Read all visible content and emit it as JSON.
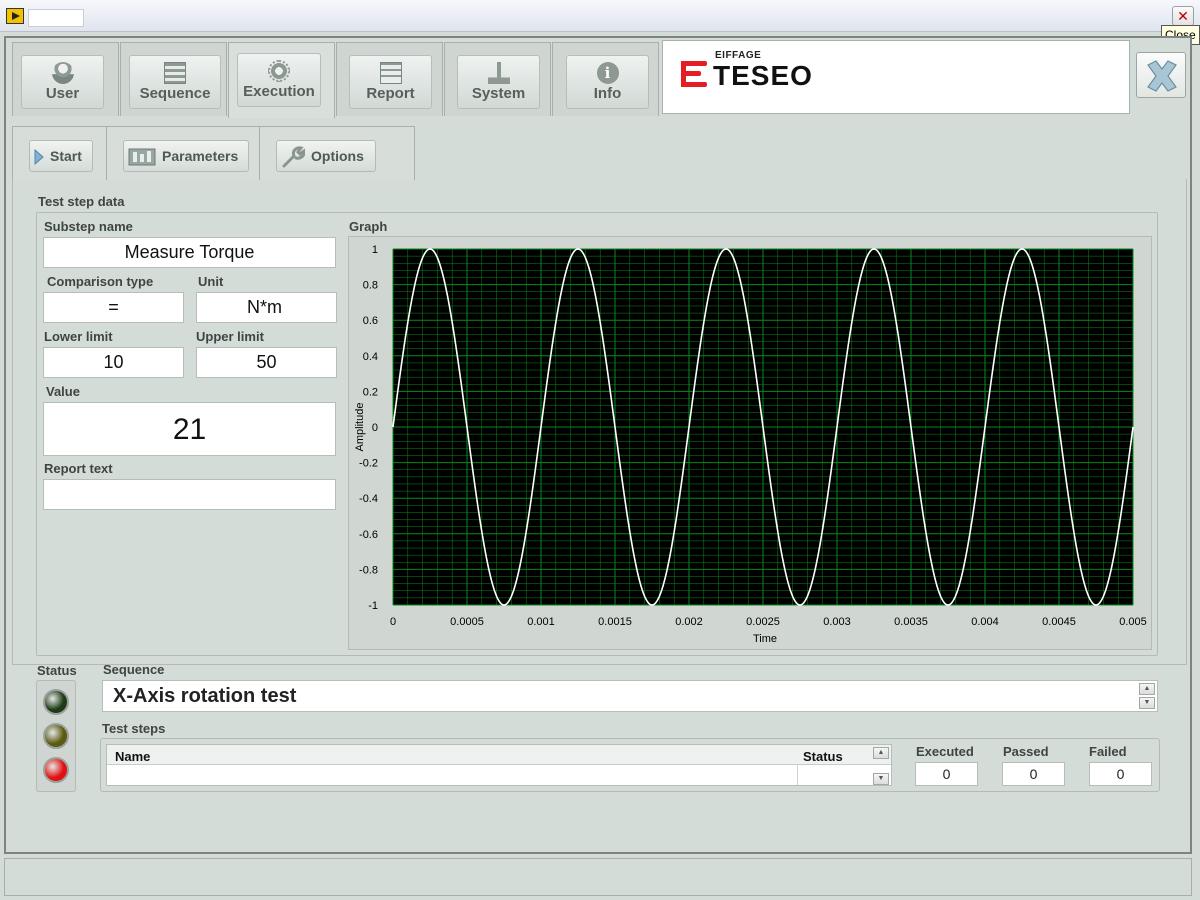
{
  "window": {
    "close_glyph": "✕",
    "close_tooltip": "Close"
  },
  "main_tabs": [
    {
      "label": "User",
      "icon": "user-icon"
    },
    {
      "label": "Sequence",
      "icon": "sequence-icon"
    },
    {
      "label": "Execution",
      "icon": "execution-icon"
    },
    {
      "label": "Report",
      "icon": "report-icon"
    },
    {
      "label": "System",
      "icon": "system-icon"
    },
    {
      "label": "Info",
      "icon": "info-icon"
    }
  ],
  "active_main_tab": "Execution",
  "logo": {
    "small": "EIFFAGE",
    "big": "TESEO",
    "accent": "#e31e24"
  },
  "sub_tabs": [
    {
      "label": "Start",
      "icon": "play-icon"
    },
    {
      "label": "Parameters",
      "icon": "parameters-icon"
    },
    {
      "label": "Options",
      "icon": "wrench-icon"
    }
  ],
  "test_step": {
    "section_label": "Test step data",
    "substep_label": "Substep name",
    "substep_value": "Measure Torque",
    "comparison_label": "Comparison type",
    "comparison_value": "=",
    "unit_label": "Unit",
    "unit_value": "N*m",
    "lower_label": "Lower limit",
    "lower_value": "10",
    "upper_label": "Upper limit",
    "upper_value": "50",
    "value_label": "Value",
    "value_value": "21",
    "report_label": "Report text",
    "report_value": ""
  },
  "graph": {
    "label": "Graph"
  },
  "chart_data": {
    "type": "line",
    "title": "",
    "xlabel": "Time",
    "ylabel": "Amplitude",
    "xlim": [
      0,
      0.005
    ],
    "ylim": [
      -1,
      1
    ],
    "x_ticks": [
      "0",
      "0.0005",
      "0.001",
      "0.0015",
      "0.002",
      "0.0025",
      "0.003",
      "0.0035",
      "0.004",
      "0.0045",
      "0.005"
    ],
    "y_ticks": [
      "1",
      "0.8",
      "0.6",
      "0.4",
      "0.2",
      "0",
      "-0.2",
      "-0.4",
      "-0.6",
      "-0.8",
      "-1"
    ],
    "grid": true,
    "background": "#000000",
    "grid_color": "#0a8a1a",
    "line_color": "#ffffff",
    "series": [
      {
        "function": "sine",
        "amplitude": 1,
        "frequency_hz": 1000,
        "x_start": 0,
        "x_end": 0.005
      }
    ]
  },
  "status": {
    "label": "Status",
    "lamps": [
      {
        "name": "status-lamp-green",
        "color": "#1e3b16"
      },
      {
        "name": "status-lamp-yellow",
        "color": "#5b5a12"
      },
      {
        "name": "status-lamp-red",
        "color": "#e21111"
      }
    ]
  },
  "sequence": {
    "label": "Sequence",
    "value": "X-Axis rotation test"
  },
  "test_steps": {
    "label": "Test steps",
    "columns": [
      "Name",
      "Status"
    ],
    "executed_label": "Executed",
    "executed_value": "0",
    "passed_label": "Passed",
    "passed_value": "0",
    "failed_label": "Failed",
    "failed_value": "0"
  }
}
